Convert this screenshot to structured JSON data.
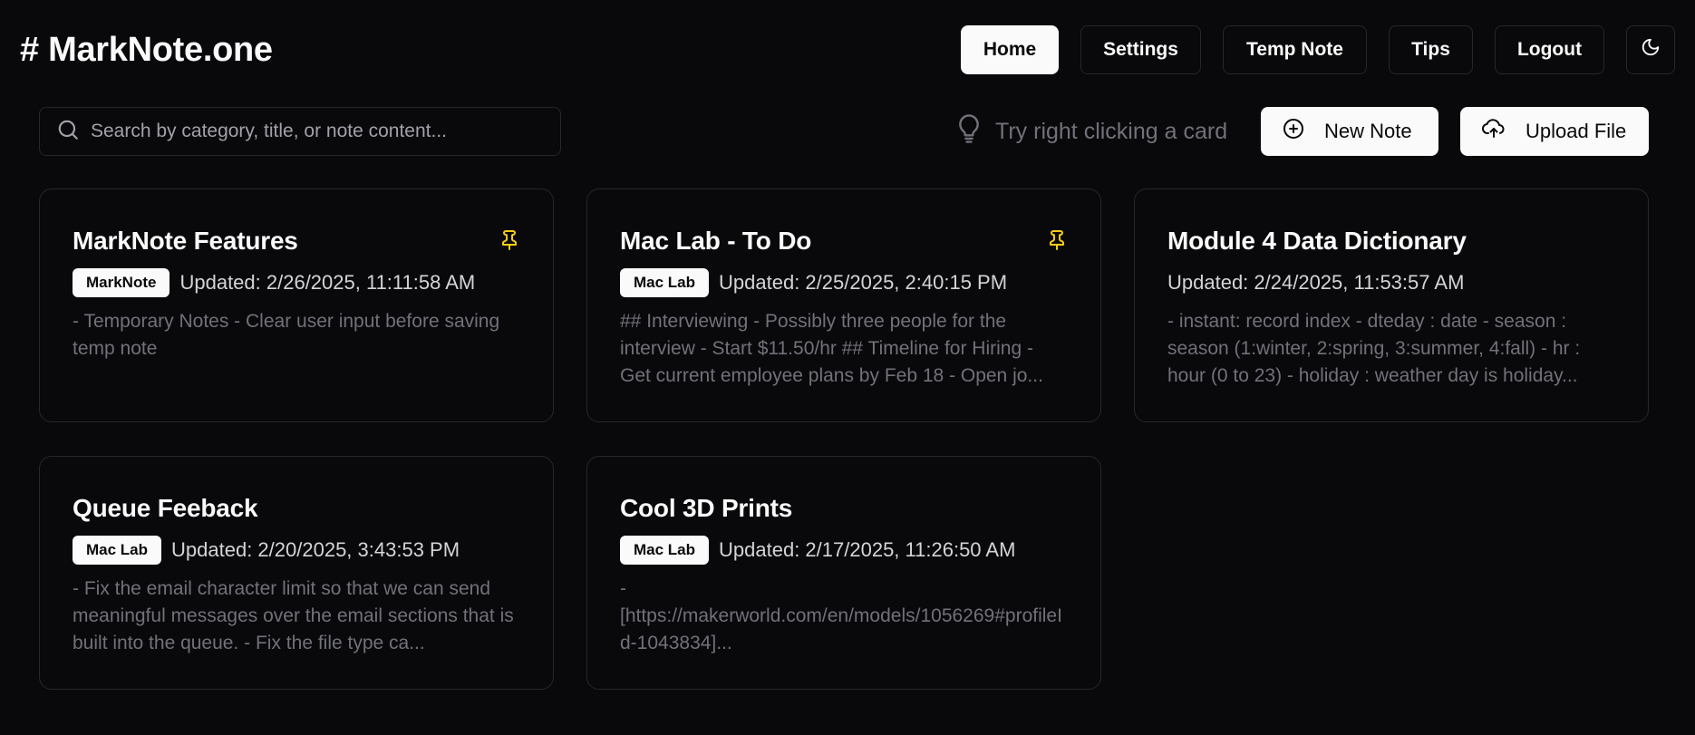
{
  "app": {
    "logo": "# MarkNote.one"
  },
  "nav": {
    "home": "Home",
    "settings": "Settings",
    "temp_note": "Temp Note",
    "tips": "Tips",
    "logout": "Logout",
    "theme_icon": "moon-icon"
  },
  "search": {
    "placeholder": "Search by category, title, or note content...",
    "value": ""
  },
  "tip": {
    "text": "Try right clicking a card",
    "icon": "lightbulb-icon"
  },
  "actions": {
    "new_note": "New Note",
    "new_note_icon": "plus-circle-icon",
    "upload_file": "Upload File",
    "upload_icon": "cloud-upload-icon"
  },
  "colors": {
    "background": "#09090b",
    "pin": "#facc15",
    "border": "#27272a"
  },
  "cards": [
    {
      "title": "MarkNote Features",
      "pinned": true,
      "category": "MarkNote",
      "updated": "Updated: 2/26/2025, 11:11:58 AM",
      "preview": "- Temporary Notes - Clear user input before saving temp note"
    },
    {
      "title": "Mac Lab - To Do",
      "pinned": true,
      "category": "Mac Lab",
      "updated": "Updated: 2/25/2025, 2:40:15 PM",
      "preview": "## Interviewing - Possibly three people for the interview - Start $11.50/hr ## Timeline for Hiring - Get current employee plans by Feb 18 - Open jo..."
    },
    {
      "title": "Module 4 Data Dictionary",
      "pinned": false,
      "category": "",
      "updated": "Updated: 2/24/2025, 11:53:57 AM",
      "preview": "- instant: record index - dteday : date - season : season (1:winter, 2:spring, 3:summer, 4:fall) - hr : hour (0 to 23) - holiday : weather day is holiday..."
    },
    {
      "title": "Queue Feeback",
      "pinned": false,
      "category": "Mac Lab",
      "updated": "Updated: 2/20/2025, 3:43:53 PM",
      "preview": "- Fix the email character limit so that we can send meaningful messages over the email sections that is built into the queue. - Fix the file type ca..."
    },
    {
      "title": "Cool 3D Prints",
      "pinned": false,
      "category": "Mac Lab",
      "updated": "Updated: 2/17/2025, 11:26:50 AM",
      "preview": "- [https://makerworld.com/en/models/1056269#profileId-1043834]..."
    }
  ]
}
